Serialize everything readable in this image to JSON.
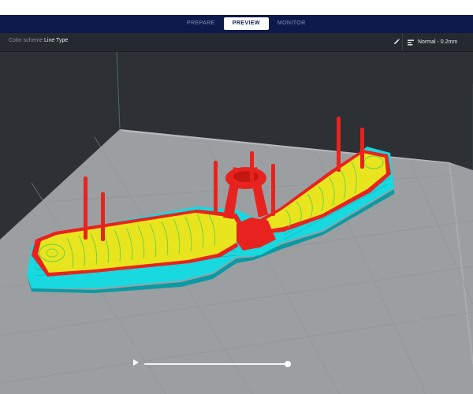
{
  "stage_tabs": [
    {
      "label": "PREPARE",
      "active": false
    },
    {
      "label": "PREVIEW",
      "active": true
    },
    {
      "label": "MONITOR",
      "active": false
    }
  ],
  "settings_bar": {
    "color_scheme_label": "Color scheme",
    "color_scheme_value": "Line Type",
    "edit_icon": "pencil-icon",
    "profile_icon": "print-settings-icon",
    "profile_label": "Normal - 0.2mm"
  },
  "simulation": {
    "play_icon": "play-icon",
    "progress": 1.0
  },
  "colors": {
    "header_bg": "#0b1a4b",
    "settings_bg": "#262a30",
    "viewport_bg": "#2d3135",
    "build_plate": "#9c9fa2",
    "wall_outer": "#e8231f",
    "wall_inner": "#7bd43c",
    "infill": "#e8e51f",
    "support": "#18d8e0",
    "skirt": "#0fc7d0"
  }
}
